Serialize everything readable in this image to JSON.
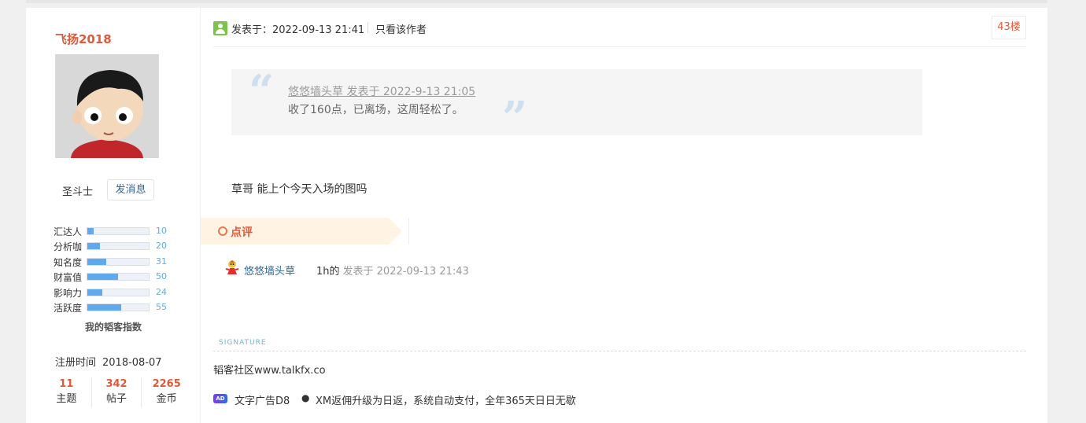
{
  "sidebar": {
    "username": "飞扬2018",
    "rank": "圣斗士",
    "message_button": "发消息",
    "stats": [
      {
        "label": "汇达人",
        "value": 10
      },
      {
        "label": "分析咖",
        "value": 20
      },
      {
        "label": "知名度",
        "value": 31
      },
      {
        "label": "财富值",
        "value": 50
      },
      {
        "label": "影响力",
        "value": 24
      },
      {
        "label": "活跃度",
        "value": 55
      }
    ],
    "index_title": "我的韬客指数",
    "register_label": "注册时间",
    "register_date": "2018-08-07",
    "counts": [
      {
        "num": "11",
        "label": "主题"
      },
      {
        "num": "342",
        "label": "帖子"
      },
      {
        "num": "2265",
        "label": "金币"
      }
    ]
  },
  "post": {
    "posted_at": "发表于：2022-09-13 21:41",
    "only_author": "只看该作者",
    "floor": "43楼",
    "quote": {
      "author_line": "悠悠墙头草 发表于 2022-9-13 21:05",
      "text": "收了160点，已离场，这周轻松了。"
    },
    "body": "草哥 能上个今天入场的图吗",
    "comment_section_label": "点评",
    "comment": {
      "user": "悠悠墙头草",
      "text": "1h的",
      "time": "发表于 2022-09-13 21:43"
    },
    "signature_label": "SIGNATURE",
    "signature_text": "韬客社区www.talkfx.co",
    "ad": {
      "icon_text": "AD",
      "label": "文字广告D8",
      "dot": "●",
      "text": "XM返佣升级为日返，系统自动支付，全年365天日日无歇"
    }
  },
  "colors": {
    "accent": "#e05a3a",
    "link": "#336699",
    "bar": "#5fa9ec"
  }
}
